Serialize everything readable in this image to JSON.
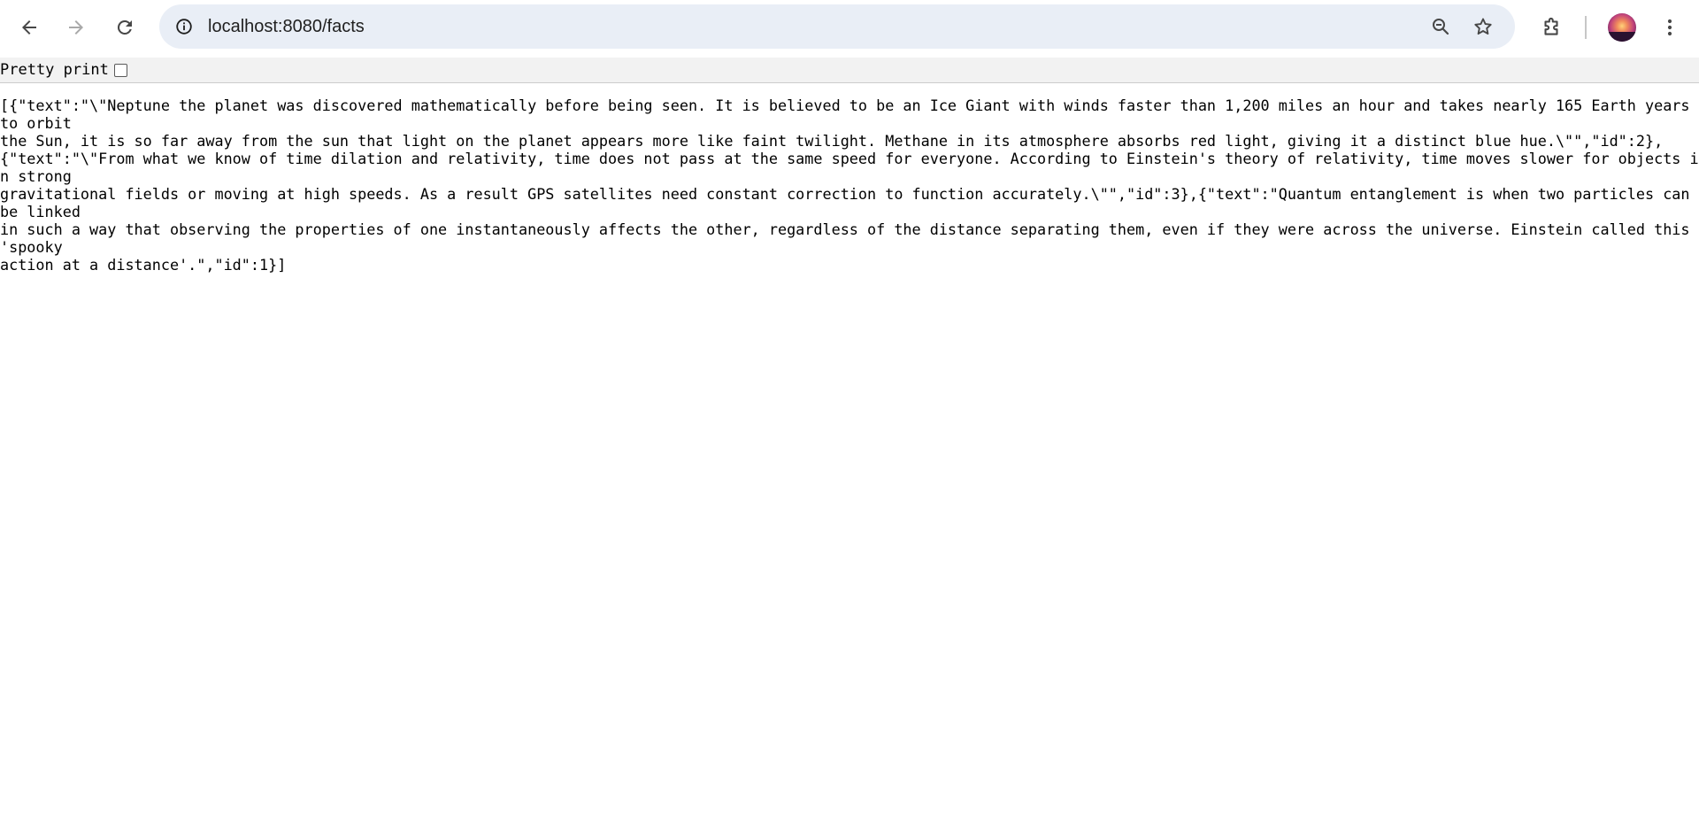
{
  "browser": {
    "url": "localhost:8080/facts",
    "icons": {
      "back": "arrow-left-icon",
      "forward": "arrow-right-icon",
      "reload": "reload-icon",
      "site_info": "info-icon",
      "zoom": "zoom-out-icon",
      "bookmark": "star-icon",
      "extensions": "puzzle-icon",
      "menu": "more-vert-icon"
    },
    "colors": {
      "omnibox_bg": "#e9eef6",
      "forward_disabled": "#a9a9a9"
    }
  },
  "pretty_print": {
    "label": "Pretty print",
    "checked": false
  },
  "json_lines": [
    "[{\"text\":\"\\\"Neptune the planet was discovered mathematically before being seen. It is believed to be an Ice Giant with winds faster than 1,200 miles an hour and takes nearly 165 Earth years to orbit",
    "the Sun, it is so far away from the sun that light on the planet appears more like faint twilight. Methane in its atmosphere absorbs red light, giving it a distinct blue hue.\\\"\",\"id\":2},",
    "{\"text\":\"\\\"From what we know of time dilation and relativity, time does not pass at the same speed for everyone. According to Einstein's theory of relativity, time moves slower for objects in strong",
    "gravitational fields or moving at high speeds. As a result GPS satellites need constant correction to function accurately.\\\"\",\"id\":3},{\"text\":\"Quantum entanglement is when two particles can be linked",
    "in such a way that observing the properties of one instantaneously affects the other, regardless of the distance separating them, even if they were across the universe. Einstein called this 'spooky",
    "action at a distance'.\",\"id\":1}]"
  ]
}
